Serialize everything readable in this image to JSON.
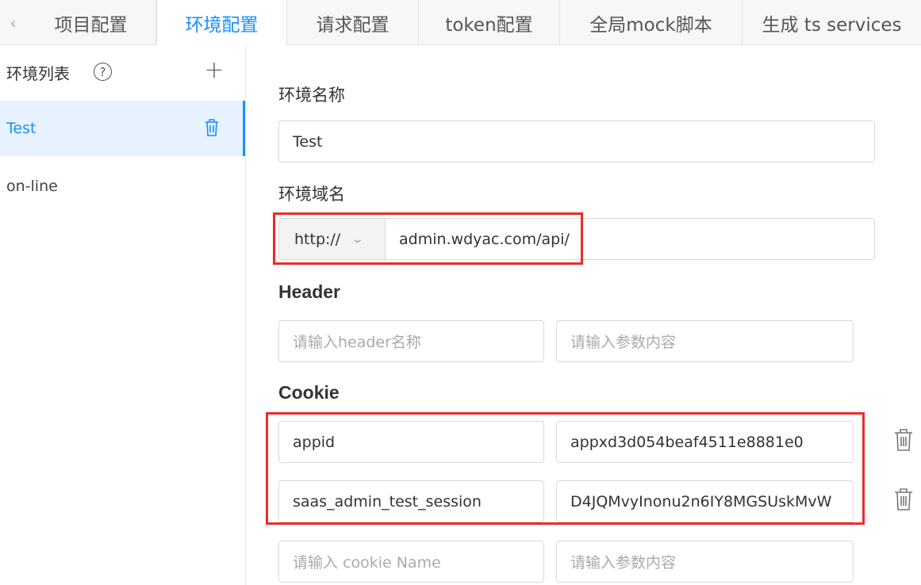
{
  "tabs": {
    "prev_icon": "chevron-left-icon",
    "items": [
      {
        "label": "项目配置",
        "active": false
      },
      {
        "label": "环境配置",
        "active": true
      },
      {
        "label": "请求配置",
        "active": false
      },
      {
        "label": "token配置",
        "active": false
      },
      {
        "label": "全局mock脚本",
        "active": false
      },
      {
        "label": "生成 ts services",
        "active": false
      }
    ]
  },
  "sidebar": {
    "title": "环境列表",
    "help_icon": "question-circle-icon",
    "add_icon": "plus-icon",
    "items": [
      {
        "label": "Test",
        "active": true,
        "icon": "trash-icon"
      },
      {
        "label": "on-line",
        "active": false
      }
    ]
  },
  "form": {
    "env_name": {
      "label": "环境名称",
      "value": "Test"
    },
    "env_domain": {
      "label": "环境域名",
      "protocol": "http://",
      "value": "admin.wdyac.com/api/"
    },
    "header": {
      "label": "Header",
      "name_placeholder": "请输入header名称",
      "value_placeholder": "请输入参数内容"
    },
    "cookie": {
      "label": "Cookie",
      "rows": [
        {
          "name": "appid",
          "value": "appxd3d054beaf4511e8881e0"
        },
        {
          "name": "saas_admin_test_session",
          "value": "D4JQMvyInonu2n6IY8MGSUskMvW"
        }
      ],
      "name_placeholder": "请输入 cookie Name",
      "value_placeholder": "请输入参数内容"
    }
  },
  "colors": {
    "accent": "#1890ff",
    "highlight_box": "#ee2a2a",
    "active_bg": "#e6f2ff"
  }
}
